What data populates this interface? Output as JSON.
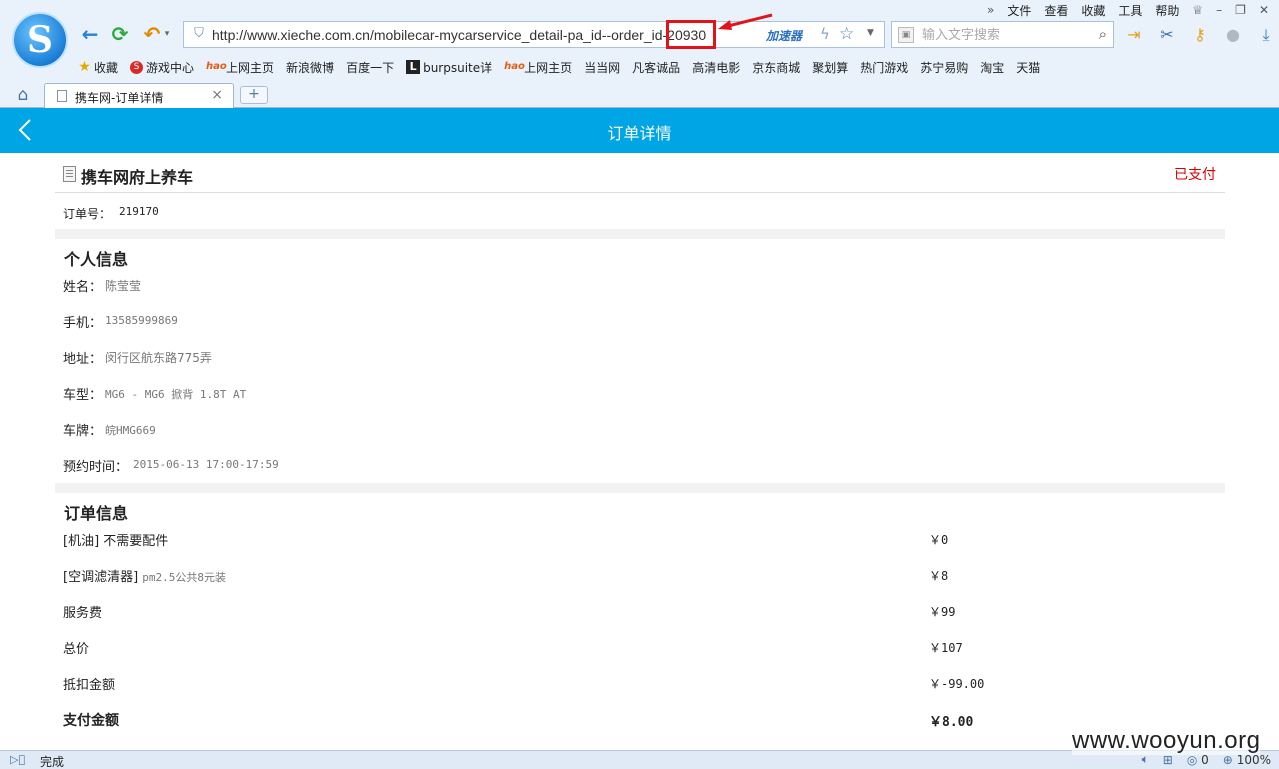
{
  "browser": {
    "menu": [
      "文件",
      "查看",
      "收藏",
      "工具",
      "帮助"
    ],
    "address": {
      "url": "http://www.xieche.com.cn/mobilecar-mycarservice_detail-pa_id--order_id-20930",
      "accelerator_label": "加速器"
    },
    "search": {
      "placeholder": "输入文字搜索"
    },
    "bookmarks": [
      {
        "label": "收藏",
        "icon": "star"
      },
      {
        "label": "游戏中心",
        "icon": "game"
      },
      {
        "label": "上网主页",
        "icon": "hao"
      },
      {
        "label": "新浪微博",
        "icon": "page"
      },
      {
        "label": "百度一下",
        "icon": "page"
      },
      {
        "label": "burpsuite详",
        "icon": "burp"
      },
      {
        "label": "上网主页",
        "icon": "hao"
      },
      {
        "label": "当当网",
        "icon": "page"
      },
      {
        "label": "凡客诚品",
        "icon": "page"
      },
      {
        "label": "高清电影",
        "icon": "page"
      },
      {
        "label": "京东商城",
        "icon": "page"
      },
      {
        "label": "聚划算",
        "icon": "page"
      },
      {
        "label": "热门游戏",
        "icon": "page"
      },
      {
        "label": "苏宁易购",
        "icon": "page"
      },
      {
        "label": "淘宝",
        "icon": "page"
      },
      {
        "label": "天猫",
        "icon": "page"
      }
    ],
    "tab": {
      "title": "携车网-订单详情"
    },
    "status": {
      "text": "完成",
      "count": "0",
      "zoom": "100%"
    }
  },
  "page": {
    "header_title": "订单详情",
    "shop_name": "携车网府上养车",
    "pay_status": "已支付",
    "order_no_label": "订单号：",
    "order_no": "219170",
    "personal": {
      "title": "个人信息",
      "rows": [
        {
          "label": "姓名：",
          "value": "陈莹莹"
        },
        {
          "label": "手机：",
          "value": "13585999869"
        },
        {
          "label": "地址：",
          "value": "闵行区航东路775弄"
        },
        {
          "label": "车型：",
          "value": "MG6 - MG6 掀背 1.8T AT"
        },
        {
          "label": "车牌：",
          "value": "皖HMG669"
        },
        {
          "label": "预约时间：",
          "value": "2015-06-13 17:00-17:59"
        }
      ]
    },
    "order": {
      "title": "订单信息",
      "rows": [
        {
          "label": "[机油] 不需要配件",
          "sub": "",
          "amount": "￥0"
        },
        {
          "label": "[空调滤清器] ",
          "sub": "pm2.5公共8元装",
          "amount": "￥8"
        },
        {
          "label": "服务费",
          "sub": "",
          "amount": "￥99"
        },
        {
          "label": "总价",
          "sub": "",
          "amount": "￥107"
        },
        {
          "label": "抵扣金额",
          "sub": "",
          "amount": "￥-99.00"
        },
        {
          "label": "支付金额",
          "sub": "",
          "amount": "￥8.00"
        }
      ]
    }
  },
  "watermark": "www.wooyun.org",
  "colors": {
    "header": "#00a5e6",
    "paid": "#d40000",
    "annotation": "#e0141a"
  }
}
